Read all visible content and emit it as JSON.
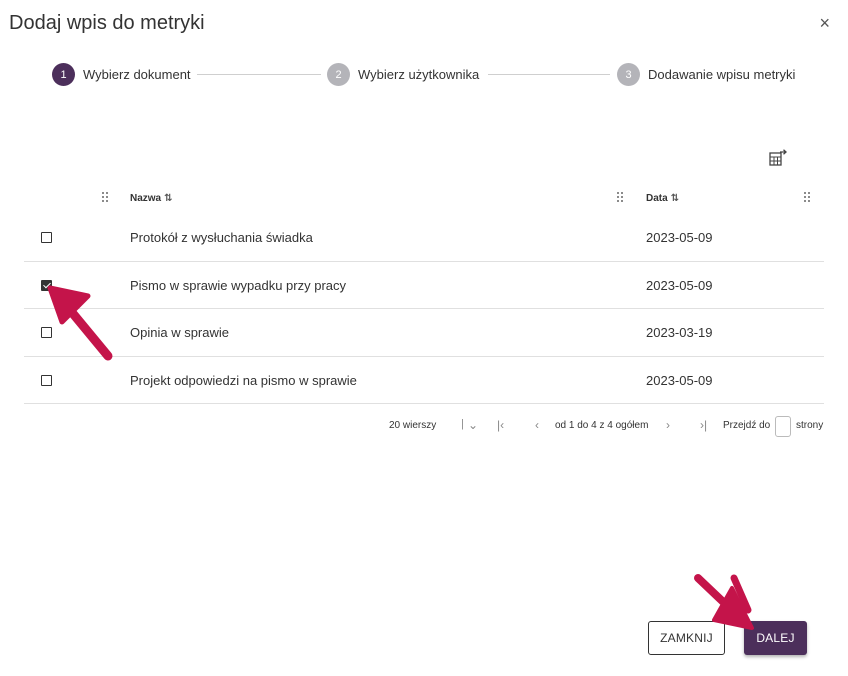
{
  "dialog": {
    "title": "Dodaj wpis do metryki",
    "close_label": "×"
  },
  "stepper": [
    {
      "number": "1",
      "label": "Wybierz dokument",
      "active": true
    },
    {
      "number": "2",
      "label": "Wybierz użytkownika",
      "active": false
    },
    {
      "number": "3",
      "label": "Dodawanie wpisu metryki",
      "active": false
    }
  ],
  "table": {
    "columns": {
      "name": "Nazwa",
      "date": "Data"
    },
    "sort_icon": "⇅",
    "rows": [
      {
        "name": "Protokół z wysłuchania świadka",
        "date": "2023-05-09",
        "checked": false
      },
      {
        "name": "Pismo w sprawie wypadku przy pracy",
        "date": "2023-05-09",
        "checked": true
      },
      {
        "name": "Opinia w sprawie",
        "date": "2023-03-19",
        "checked": false
      },
      {
        "name": "Projekt odpowiedzi na pismo w sprawie",
        "date": "2023-05-09",
        "checked": false
      }
    ]
  },
  "pagination": {
    "rows_per_page": "20 wierszy",
    "range_text": "od 1 do 4 z 4 ogółem",
    "goto_label": "Przejdź do",
    "pages_label": "strony"
  },
  "buttons": {
    "cancel": "ZAMKNIJ",
    "next": "DALEJ"
  },
  "colors": {
    "accent": "#4c2f5b",
    "annotation_arrow": "#c4144a"
  },
  "icons": {
    "export": "export-table-icon",
    "drag": "drag-handle-icon",
    "sort": "sort-icon"
  }
}
